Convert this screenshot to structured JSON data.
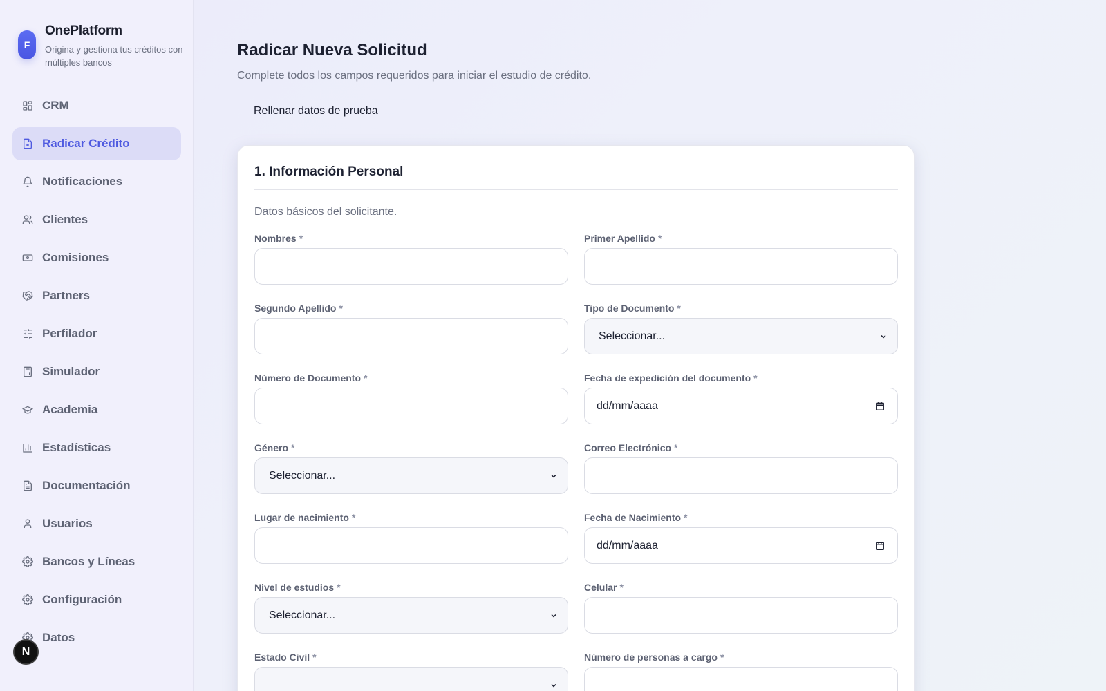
{
  "brand": {
    "logo_letter": "F",
    "name": "OnePlatform",
    "tagline": "Origina y gestiona tus créditos con múltiples bancos"
  },
  "sidebar": {
    "items": [
      {
        "label": "CRM",
        "icon": "grid-icon",
        "active": false
      },
      {
        "label": "Radicar Crédito",
        "icon": "file-plus-icon",
        "active": true
      },
      {
        "label": "Notificaciones",
        "icon": "bell-icon",
        "active": false
      },
      {
        "label": "Clientes",
        "icon": "users-icon",
        "active": false
      },
      {
        "label": "Comisiones",
        "icon": "banknote-icon",
        "active": false
      },
      {
        "label": "Partners",
        "icon": "handshake-icon",
        "active": false
      },
      {
        "label": "Perfilador",
        "icon": "sliders-icon",
        "active": false
      },
      {
        "label": "Simulador",
        "icon": "calculator-icon",
        "active": false
      },
      {
        "label": "Academia",
        "icon": "graduation-cap-icon",
        "active": false
      },
      {
        "label": "Estadísticas",
        "icon": "bar-chart-icon",
        "active": false
      },
      {
        "label": "Documentación",
        "icon": "document-icon",
        "active": false
      },
      {
        "label": "Usuarios",
        "icon": "user-icon",
        "active": false
      },
      {
        "label": "Bancos y Líneas",
        "icon": "gear-icon",
        "active": false
      },
      {
        "label": "Configuración",
        "icon": "gear-icon",
        "active": false
      },
      {
        "label": "Datos",
        "icon": "gear-icon",
        "active": false
      }
    ]
  },
  "dev_badge": {
    "letter": "N"
  },
  "page": {
    "title": "Radicar Nueva Solicitud",
    "subtitle": "Complete todos los campos requeridos para iniciar el estudio de crédito.",
    "fill_test_label": "Rellenar datos de prueba"
  },
  "section": {
    "title": "1. Información Personal",
    "description": "Datos básicos del solicitante.",
    "required_mark": "*",
    "fields": [
      {
        "label": "Nombres",
        "type": "text",
        "value": ""
      },
      {
        "label": "Primer Apellido",
        "type": "text",
        "value": ""
      },
      {
        "label": "Segundo Apellido",
        "type": "text",
        "value": ""
      },
      {
        "label": "Tipo de Documento",
        "type": "select",
        "value": "Seleccionar..."
      },
      {
        "label": "Número de Documento",
        "type": "text",
        "value": ""
      },
      {
        "label": "Fecha de expedición del documento",
        "type": "date",
        "value": "dd/mm/aaaa"
      },
      {
        "label": "Género",
        "type": "select",
        "value": "Seleccionar..."
      },
      {
        "label": "Correo Electrónico",
        "type": "text",
        "value": ""
      },
      {
        "label": "Lugar de nacimiento",
        "type": "text",
        "value": ""
      },
      {
        "label": "Fecha de Nacimiento",
        "type": "date",
        "value": "dd/mm/aaaa"
      },
      {
        "label": "Nivel de estudios",
        "type": "select",
        "value": "Seleccionar..."
      },
      {
        "label": "Celular",
        "type": "text",
        "value": ""
      },
      {
        "label": "Estado Civil",
        "type": "select",
        "value": ""
      },
      {
        "label": "Número de personas a cargo",
        "type": "text",
        "value": ""
      }
    ]
  },
  "colors": {
    "accent": "#4f5ae0",
    "active_bg": "#dcdcf7",
    "text": "#1d2131",
    "muted": "#6b7080"
  }
}
